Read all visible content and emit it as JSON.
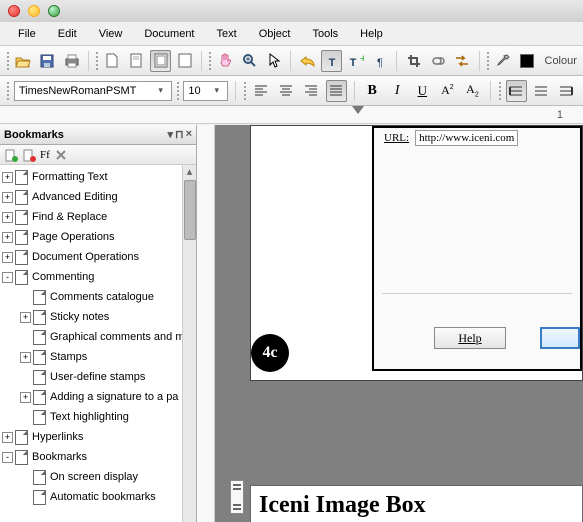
{
  "menubar": [
    "File",
    "Edit",
    "View",
    "Document",
    "Text",
    "Object",
    "Tools",
    "Help"
  ],
  "font": {
    "name": "TimesNewRomanPSMT",
    "size": "10"
  },
  "color_label": "Colour",
  "bookmarks_panel": {
    "title": "Bookmarks",
    "toolbar_ff": "Ff"
  },
  "tree": [
    {
      "level": 0,
      "toggle": "+",
      "label": "Formatting Text"
    },
    {
      "level": 0,
      "toggle": "+",
      "label": "Advanced Editing"
    },
    {
      "level": 0,
      "toggle": "+",
      "label": "Find & Replace"
    },
    {
      "level": 0,
      "toggle": "+",
      "label": "Page Operations"
    },
    {
      "level": 0,
      "toggle": "+",
      "label": "Document Operations"
    },
    {
      "level": 0,
      "toggle": "-",
      "label": "Commenting"
    },
    {
      "level": 1,
      "toggle": "",
      "label": "Comments catalogue"
    },
    {
      "level": 1,
      "toggle": "+",
      "label": "Sticky notes"
    },
    {
      "level": 1,
      "toggle": "",
      "label": "Graphical comments and m"
    },
    {
      "level": 1,
      "toggle": "+",
      "label": "Stamps"
    },
    {
      "level": 1,
      "toggle": "",
      "label": "User-define stamps"
    },
    {
      "level": 1,
      "toggle": "+",
      "label": "Adding a signature to a pa"
    },
    {
      "level": 1,
      "toggle": "",
      "label": "Text highlighting"
    },
    {
      "level": 0,
      "toggle": "+",
      "label": "Hyperlinks"
    },
    {
      "level": 0,
      "toggle": "-",
      "label": "Bookmarks"
    },
    {
      "level": 1,
      "toggle": "",
      "label": "On screen display"
    },
    {
      "level": 1,
      "toggle": "",
      "label": "Automatic bookmarks"
    }
  ],
  "ruler": {
    "label_1": "1"
  },
  "dialog": {
    "url_label": "URL:",
    "url_value": "http://www.iceni.com",
    "help": "Help",
    "circle": "4c"
  },
  "heading": "Iceni Image Box",
  "icons": {
    "open": "open-folder-icon",
    "save": "save-icon",
    "print": "print-icon",
    "doc1": "new-page-icon",
    "doc2": "page-icon",
    "doc3": "page-frame-icon",
    "doc4": "page-fit-icon",
    "hand": "hand-icon",
    "zoom": "zoom-icon",
    "pointer": "pointer-icon",
    "undo": "undo-icon",
    "redo": "redo-icon",
    "text": "text-tool-icon",
    "textadd": "text-add-icon",
    "textpara": "paragraph-icon",
    "crop": "crop-icon",
    "link": "link-icon",
    "wave": "swap-icon",
    "eyedrop": "eyedropper-icon"
  }
}
